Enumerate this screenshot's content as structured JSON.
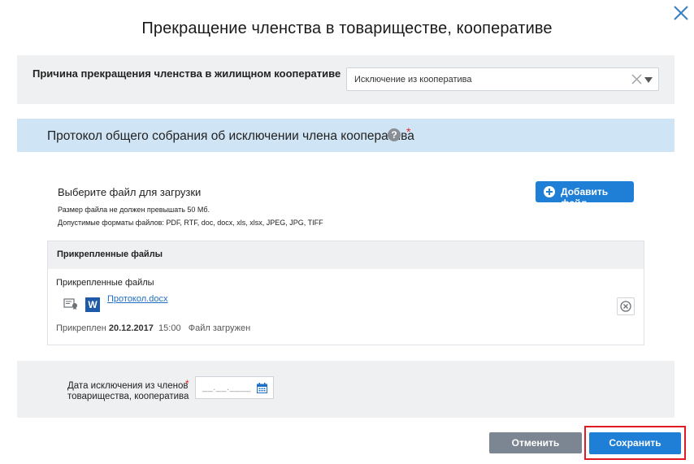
{
  "dialog": {
    "title": "Прекращение членства в товариществе, кооперативе"
  },
  "reason": {
    "label": "Причина прекращения членства в жилищном кооперативе",
    "selected": "Исключение из кооператива"
  },
  "protocol": {
    "title": "Протокол общего собрания об исключении члена кооператива",
    "help_icon": "?",
    "required": "*"
  },
  "upload": {
    "label": "Выберите файл для загрузки",
    "note_size": "Размер файла не должен превышать 50 Мб.",
    "note_formats": "Допустимые форматы файлов: PDF, RTF, doc, docx, xls, xlsx, JPEG, JPG, TIFF",
    "add_button": "Добавить файл"
  },
  "attached": {
    "header": "Прикрепленные файлы",
    "subheader": "Прикрепленные файлы",
    "file_icon_letter": "W",
    "file_name": "Протокол.docx",
    "attached_prefix": "Прикреплен",
    "date": "20.12.2017",
    "time": "15:00",
    "status": "Файл загружен"
  },
  "date_field": {
    "label": "Дата исключения из членов товарищества, кооператива",
    "required": "*",
    "placeholder": "__.__.____"
  },
  "actions": {
    "cancel": "Отменить",
    "save": "Сохранить"
  },
  "colors": {
    "accent": "#1f7fd6",
    "highlight": "#e01b24",
    "section_header": "#cfe4f4"
  }
}
